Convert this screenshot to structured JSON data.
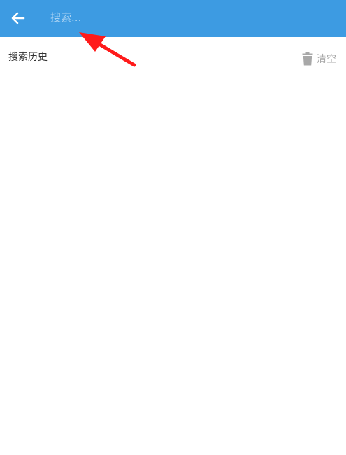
{
  "header": {
    "back_icon": "arrow-left-icon",
    "search_placeholder": "搜索..."
  },
  "history": {
    "title": "搜索历史",
    "clear_icon": "trash-icon",
    "clear_label": "清空"
  },
  "colors": {
    "app_bar": "#3d9be2",
    "annotation": "#ff1a1a"
  }
}
